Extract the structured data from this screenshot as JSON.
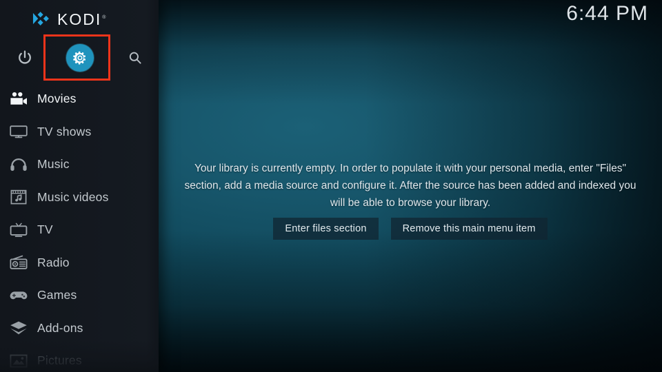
{
  "app": {
    "name": "KODI",
    "trademark": "®",
    "logo_color": "#25a6e0"
  },
  "clock": {
    "time": "6:44 PM"
  },
  "top_bar": {
    "power": {
      "label": "Power",
      "icon": "power-icon"
    },
    "settings": {
      "label": "Settings",
      "icon": "gear-icon",
      "circle_color": "#1f93bd",
      "highlighted": true
    },
    "search": {
      "label": "Search",
      "icon": "search-icon"
    }
  },
  "annotation": {
    "color": "#f0341a",
    "shape": "rectangle",
    "target": "settings-button"
  },
  "sidebar": {
    "items": [
      {
        "label": "Movies",
        "icon": "movie-camera-icon",
        "state": "selected"
      },
      {
        "label": "TV shows",
        "icon": "tv-monitor-icon",
        "state": "normal"
      },
      {
        "label": "Music",
        "icon": "headphones-icon",
        "state": "normal"
      },
      {
        "label": "Music videos",
        "icon": "film-note-icon",
        "state": "normal"
      },
      {
        "label": "TV",
        "icon": "retro-tv-icon",
        "state": "normal"
      },
      {
        "label": "Radio",
        "icon": "radio-icon",
        "state": "normal"
      },
      {
        "label": "Games",
        "icon": "gamepad-icon",
        "state": "normal"
      },
      {
        "label": "Add-ons",
        "icon": "open-box-icon",
        "state": "normal"
      },
      {
        "label": "Pictures",
        "icon": "picture-icon",
        "state": "dimmed"
      }
    ]
  },
  "main": {
    "empty_message": "Your library is currently empty. In order to populate it with your personal media, enter \"Files\" section, add a media source and configure it. After the source has been added and indexed you will be able to browse your library.",
    "buttons": [
      {
        "label": "Enter files section"
      },
      {
        "label": "Remove this main menu item"
      }
    ]
  }
}
